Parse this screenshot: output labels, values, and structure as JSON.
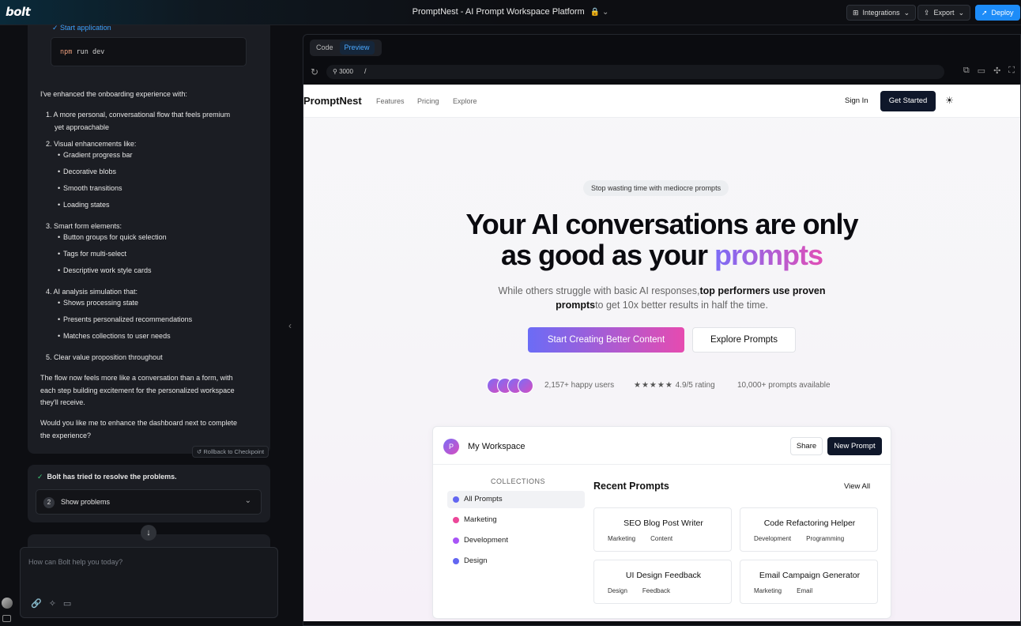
{
  "app": {
    "logo": "bolt",
    "project_title": "PromptNest - AI Prompt Workspace Platform",
    "project_icons": "🔒 ⌄",
    "buttons": {
      "integrations": "Integrations",
      "export": "Export",
      "deploy": "Deploy"
    }
  },
  "chat": {
    "start_application": "✓ Start application",
    "command_keyword": "npm",
    "command_rest": " run dev",
    "intro": "I've enhanced the onboarding experience with:",
    "items": [
      {
        "label": "1. A more personal, conversational flow that feels premium",
        "label2": "yet approachable"
      },
      {
        "label": "2. Visual enhancements like:",
        "subs": [
          "Gradient progress bar",
          "Decorative blobs",
          "Smooth transitions",
          "Loading states"
        ]
      },
      {
        "label": "3. Smart form elements:",
        "subs": [
          "Button groups for quick selection",
          "Tags for multi-select",
          "Descriptive work style cards"
        ]
      },
      {
        "label": "4. AI analysis simulation that:",
        "subs": [
          "Shows processing state",
          "Presents personalized recommendations",
          "Matches collections to user needs"
        ]
      },
      {
        "label": "5. Clear value proposition throughout"
      }
    ],
    "closing_1": "The flow now feels more like a conversation than a form, with",
    "closing_2": "each step building excitement for the personalized workspace",
    "closing_3": "they'll receive.",
    "question_1": "Would you like me to enhance the dashboard next to complete",
    "question_2": "the experience?",
    "rollback": "↺ Rollback to Checkpoint",
    "resolve_title": "Bolt has tried to resolve the problems.",
    "problems_count": "2",
    "problems_label": "Show problems",
    "input_placeholder": "How can Bolt help you today?"
  },
  "preview": {
    "tabs": [
      "Code",
      "Preview"
    ],
    "active_tab": "Preview",
    "port": "3000",
    "path": "/"
  },
  "site": {
    "logo": "PromptNest",
    "nav": [
      "Features",
      "Pricing",
      "Explore"
    ],
    "signin": "Sign In",
    "get_started": "Get Started",
    "pill": "Stop wasting time with mediocre prompts",
    "title_line1": "Your AI conversations are only",
    "title_line2_a": "as good as your ",
    "title_line2_b": "prompts",
    "sub_1a": "While others struggle with basic AI responses,",
    "sub_1b": "top performers use proven",
    "sub_2a": "prompts",
    "sub_2b": "to get 10x better results in half the time.",
    "cta_primary": "Start Creating Better Content",
    "cta_secondary": "Explore Prompts",
    "stat_users": "2,157+ happy users",
    "stat_stars": "★★★★★",
    "stat_rating": "4.9/5 rating",
    "stat_prompts": "10,000+ prompts available",
    "workspace": {
      "avatar_letter": "P",
      "title": "My Workspace",
      "share": "Share",
      "new_prompt": "New Prompt",
      "collections_heading": "COLLECTIONS",
      "collections": [
        {
          "label": "All Prompts",
          "color": "#6366f1"
        },
        {
          "label": "Marketing",
          "color": "#ec4899"
        },
        {
          "label": "Development",
          "color": "#a855f7"
        },
        {
          "label": "Design",
          "color": "#6366f1"
        }
      ],
      "recent_heading": "Recent Prompts",
      "view_all": "View All",
      "prompts": [
        {
          "title": "SEO Blog Post Writer",
          "tags": [
            "Marketing",
            "Content"
          ]
        },
        {
          "title": "Code Refactoring Helper",
          "tags": [
            "Development",
            "Programming"
          ]
        },
        {
          "title": "UI Design Feedback",
          "tags": [
            "Design",
            "Feedback"
          ]
        },
        {
          "title": "Email Campaign Generator",
          "tags": [
            "Marketing",
            "Email"
          ]
        }
      ]
    }
  }
}
